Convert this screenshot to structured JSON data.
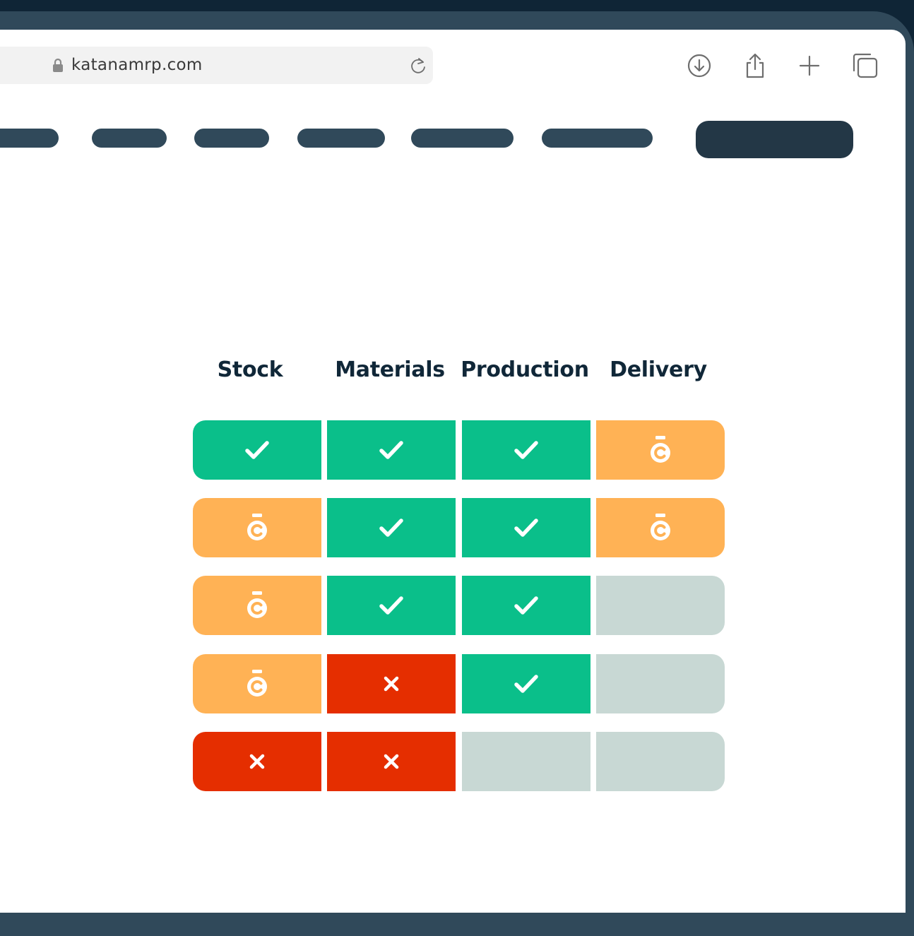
{
  "browser": {
    "url": "katanamrp.com"
  },
  "icons": {
    "lock": "lock-icon",
    "reload": "reload-icon",
    "download": "download-icon",
    "share": "share-icon",
    "new_tab": "plus-icon",
    "tabs": "tabs-icon",
    "done": "check-icon",
    "pending": "stopwatch-icon",
    "blocked": "x-icon"
  },
  "table": {
    "headers": [
      "Stock",
      "Materials",
      "Production",
      "Delivery"
    ],
    "rows": [
      [
        "done",
        "done",
        "done",
        "pending"
      ],
      [
        "pending",
        "done",
        "done",
        "pending"
      ],
      [
        "pending",
        "done",
        "done",
        "empty"
      ],
      [
        "pending",
        "blocked",
        "done",
        "empty"
      ],
      [
        "blocked",
        "blocked",
        "empty",
        "empty"
      ]
    ]
  },
  "colors": {
    "done": "#0abf8a",
    "pending": "#ffb255",
    "blocked": "#e52e00",
    "empty": "#c8d8d4",
    "header_text": "#102738",
    "nav": "#30495a",
    "cta": "#233746"
  }
}
